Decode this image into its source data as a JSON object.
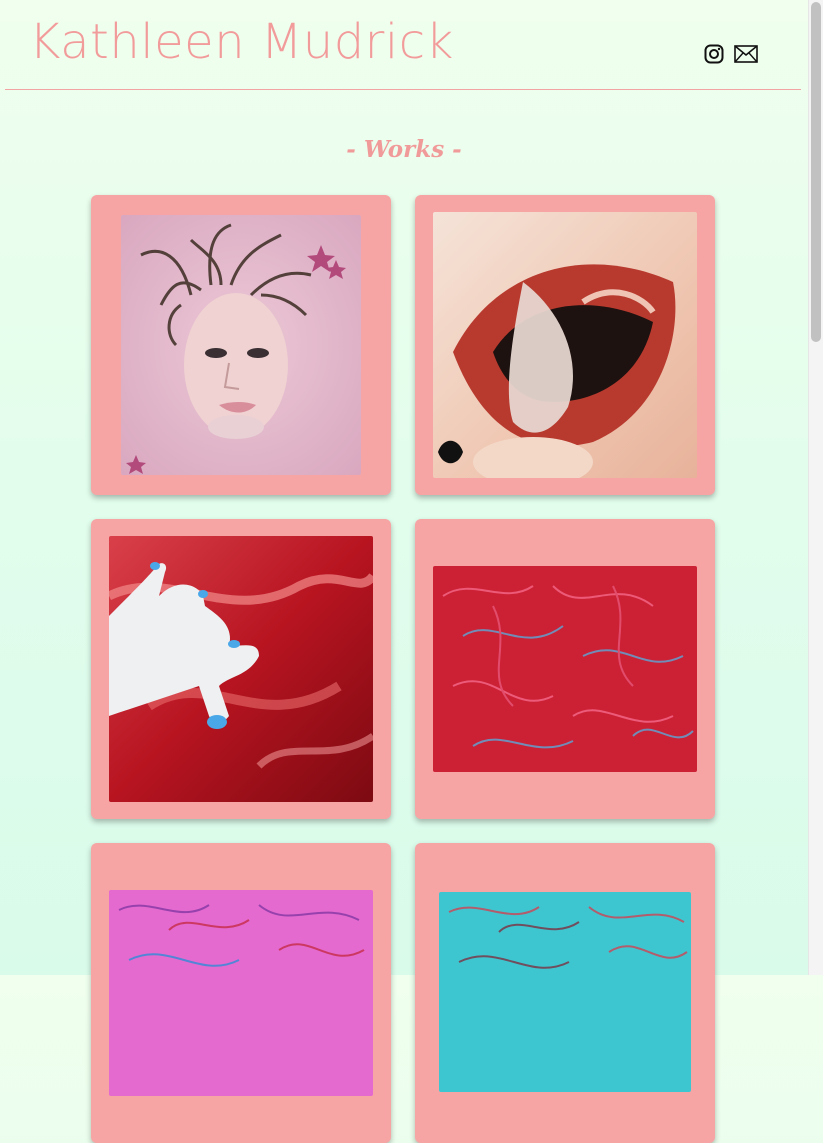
{
  "header": {
    "site_title": "Kathleen Mudrick",
    "social": [
      {
        "icon": "instagram-icon"
      },
      {
        "icon": "mail-icon"
      }
    ]
  },
  "main": {
    "section_heading": "- Works -",
    "works": [
      {
        "subject": "face in pink water"
      },
      {
        "subject": "red lips"
      },
      {
        "subject": "hand on red satin"
      },
      {
        "subject": "red abstract"
      },
      {
        "subject": "pink abstract"
      },
      {
        "subject": "turquoise abstract"
      }
    ]
  },
  "colors": {
    "accent": "#f29b9b",
    "card": "#f7a4a4",
    "background": "#eafff0"
  }
}
